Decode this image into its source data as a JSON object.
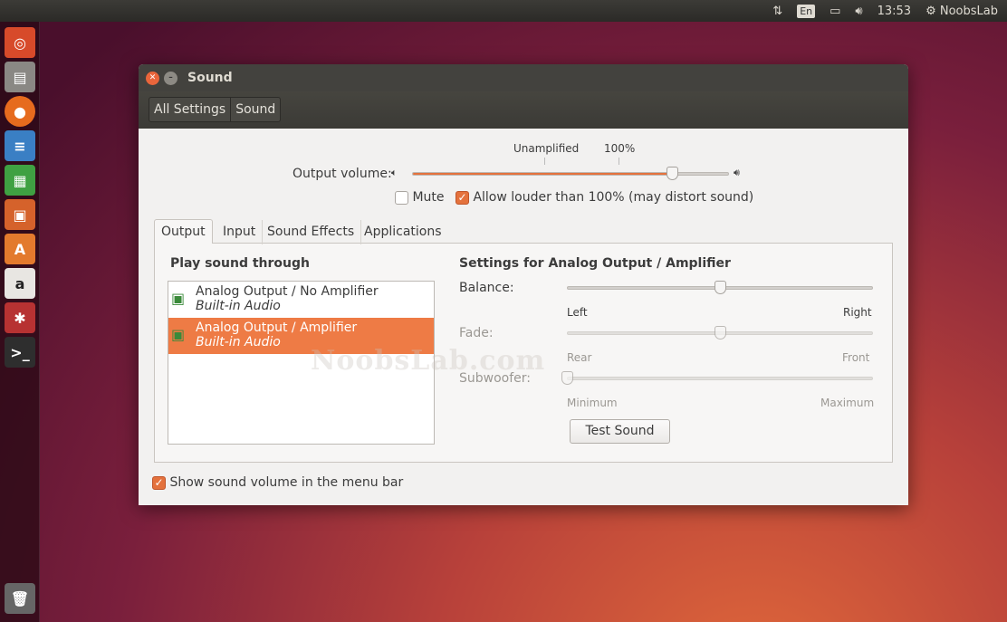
{
  "topbar": {
    "indicators": [
      "network-updown-icon",
      "keyboard-en",
      "battery-icon",
      "volume-icon"
    ],
    "keyboard": "En",
    "time": "13:53",
    "user": "NoobsLab"
  },
  "launcher": {
    "items": [
      "ubuntu-dash",
      "files",
      "firefox",
      "libreoffice-writer",
      "libreoffice-calc",
      "libreoffice-impress",
      "ubuntu-software-center",
      "amazon",
      "system-settings",
      "terminal",
      "trash"
    ]
  },
  "window": {
    "title": "Sound",
    "breadcrumb": [
      "All Settings",
      "Sound"
    ]
  },
  "volume": {
    "label": "Output volume:",
    "marks": [
      "Unamplified",
      "100%"
    ],
    "value_percent": 126,
    "mute_label": "Mute",
    "mute": false,
    "louder_label": "Allow louder than 100% (may distort sound)",
    "louder": true
  },
  "tabs": [
    "Output",
    "Input",
    "Sound Effects",
    "Applications"
  ],
  "active_tab": "Output",
  "output": {
    "list_title": "Play sound through",
    "devices": [
      {
        "name": "Analog Output / No Amplifier",
        "sub": "Built-in Audio",
        "selected": false
      },
      {
        "name": "Analog Output / Amplifier",
        "sub": "Built-in Audio",
        "selected": true
      }
    ],
    "settings_title": "Settings for Analog Output / Amplifier",
    "balance": {
      "label": "Balance:",
      "left": "Left",
      "right": "Right",
      "value": 0.5
    },
    "fade": {
      "label": "Fade:",
      "left": "Rear",
      "right": "Front",
      "value": 0.5
    },
    "subwoofer": {
      "label": "Subwoofer:",
      "left": "Minimum",
      "right": "Maximum",
      "value": 0
    },
    "test_button": "Test Sound"
  },
  "show_in_menubar": {
    "label": "Show sound volume in the menu bar",
    "checked": true
  },
  "watermark": "NoobsLab.com",
  "colors": {
    "accent": "#e4723d",
    "selection": "#ee7b45",
    "titlebar": "#43423e"
  }
}
